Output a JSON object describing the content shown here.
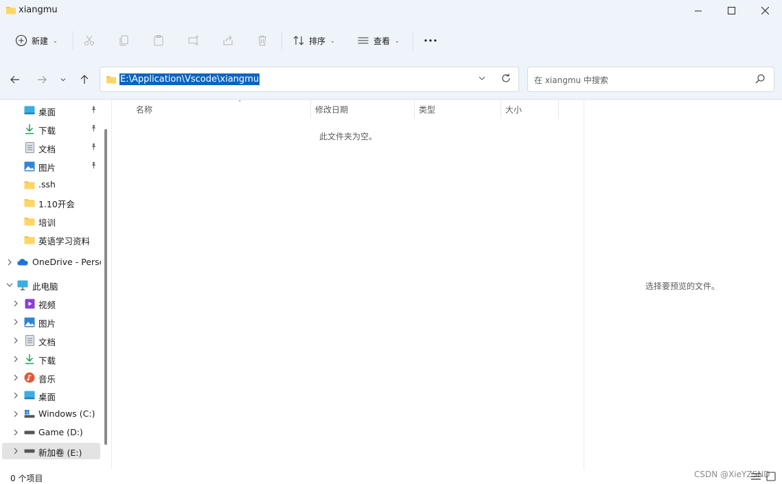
{
  "window": {
    "title": "xiangmu"
  },
  "toolbar": {
    "new_label": "新建",
    "sort_label": "排序",
    "view_label": "查看",
    "more_label": "···"
  },
  "address": {
    "path": "E:\\Application\\Vscode\\xiangmu"
  },
  "search": {
    "placeholder": "在 xiangmu 中搜索"
  },
  "sidebar": {
    "quick_access": [
      {
        "label": "桌面",
        "icon": "desktop-icon",
        "pinned": true
      },
      {
        "label": "下载",
        "icon": "download-icon",
        "pinned": true
      },
      {
        "label": "文档",
        "icon": "document-icon",
        "pinned": true
      },
      {
        "label": "图片",
        "icon": "pictures-icon",
        "pinned": true
      },
      {
        "label": ".ssh",
        "icon": "folder-icon",
        "pinned": false
      },
      {
        "label": "1.10开会",
        "icon": "folder-icon",
        "pinned": false
      },
      {
        "label": "培训",
        "icon": "folder-icon",
        "pinned": false
      },
      {
        "label": "英语学习资料",
        "icon": "folder-icon",
        "pinned": false
      }
    ],
    "onedrive": {
      "label": "OneDrive - Persc",
      "icon": "onedrive-icon"
    },
    "this_pc": {
      "label": "此电脑",
      "icon": "computer-icon"
    },
    "pc_items": [
      {
        "label": "视频",
        "icon": "videos-icon"
      },
      {
        "label": "图片",
        "icon": "pictures-icon"
      },
      {
        "label": "文档",
        "icon": "document-icon"
      },
      {
        "label": "下载",
        "icon": "download-icon"
      },
      {
        "label": "音乐",
        "icon": "music-icon"
      },
      {
        "label": "桌面",
        "icon": "desktop-icon"
      },
      {
        "label": "Windows (C:)",
        "icon": "windows-drive-icon"
      },
      {
        "label": "Game (D:)",
        "icon": "drive-icon"
      },
      {
        "label": "新加卷 (E:)",
        "icon": "drive-icon",
        "selected": true
      }
    ]
  },
  "content": {
    "columns": [
      "名称",
      "修改日期",
      "类型",
      "大小"
    ],
    "empty_message": "此文件夹为空。"
  },
  "preview": {
    "message": "选择要预览的文件。"
  },
  "status": {
    "item_count": "0 个项目",
    "watermark": "CSDN @XieYZSND"
  },
  "colors": {
    "accent": "#0b64c0",
    "chrome": "#eef4f9",
    "folder": "#f5c445"
  }
}
